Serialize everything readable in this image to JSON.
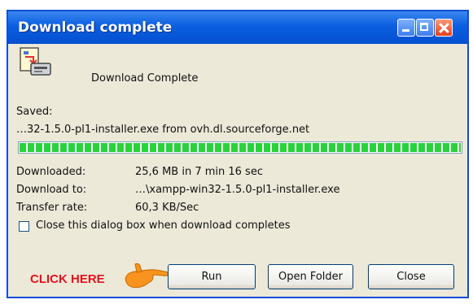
{
  "window": {
    "title": "Download complete",
    "heading": "Download Complete",
    "saved_label": "Saved:",
    "saved_value": "…32-1.5.0-pl1-installer.exe from ovh.dl.sourceforge.net",
    "progress_fraction": 1.0,
    "info": [
      {
        "label": "Downloaded:",
        "value": "25,6 MB in 7 min 16 sec"
      },
      {
        "label": "Download to:",
        "value": "…\\xampp-win32-1.5.0-pl1-installer.exe"
      },
      {
        "label": "Transfer rate:",
        "value": "60,3 KB/Sec"
      }
    ],
    "checkbox_label": "Close this dialog box when download completes",
    "checkbox_checked": false,
    "buttons": {
      "run": "Run",
      "open_folder": "Open Folder",
      "close": "Close"
    }
  },
  "annotation": {
    "text": "CLICK HERE",
    "color": "#e0141e",
    "pointer_icon": "pointing-hand-icon",
    "pointer_color": "#f7931e"
  },
  "colors": {
    "titlebar": "#0a5ee0",
    "dialog_bg": "#ece9d8",
    "progress": "#27d33b"
  }
}
